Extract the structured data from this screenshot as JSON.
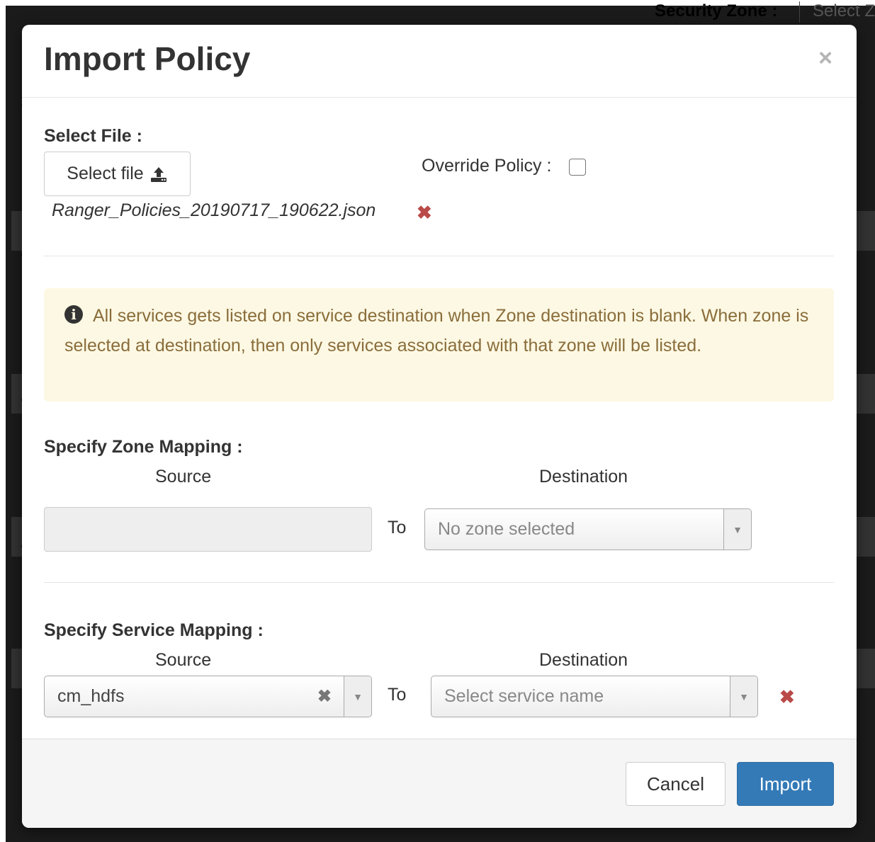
{
  "background": {
    "security_zone_label": "Security Zone :",
    "security_zone_select": "Select Zone Name"
  },
  "modal": {
    "title": "Import Policy",
    "close_glyph": "×",
    "select_file_label": "Select File :",
    "select_file_button": "Select file",
    "override_policy_label": "Override Policy :",
    "override_policy_checked": false,
    "file_name": "Ranger_Policies_20190717_190622.json",
    "remove_glyph": "✖",
    "alert_text": "All services gets listed on service destination when Zone destination is blank. When zone is selected at destination, then only services associated with that zone will be listed.",
    "zone_mapping": {
      "heading": "Specify Zone Mapping :",
      "source_header": "Source",
      "destination_header": "Destination",
      "to_label": "To",
      "source_value": "",
      "destination_placeholder": "No zone selected"
    },
    "service_mapping": {
      "heading": "Specify Service Mapping :",
      "source_header": "Source",
      "destination_header": "Destination",
      "to_label": "To",
      "source_value": "cm_hdfs",
      "destination_placeholder": "Select service name"
    },
    "footer": {
      "cancel_label": "Cancel",
      "import_label": "Import"
    }
  },
  "colors": {
    "primary": "#337ab7",
    "danger": "#b94a48",
    "alert_bg": "#fcf8e3",
    "alert_text": "#8a6d3b"
  }
}
